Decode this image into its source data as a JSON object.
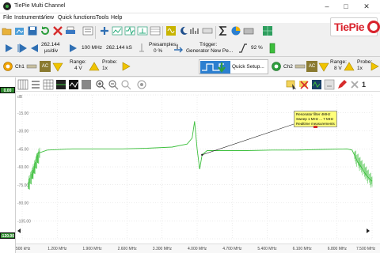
{
  "window": {
    "title": "TiePie Multi Channel",
    "minimize": "–",
    "maximize": "□",
    "close": "✕"
  },
  "menu": [
    "File",
    "Instruments",
    "View",
    "Quick functions",
    "Tools",
    "Help"
  ],
  "logo_text": "TiePie",
  "toolbar2": {
    "timebase_value": "262.144",
    "timebase_unit": "µs/div",
    "sample_rate": "100 MHz",
    "record_length": "262.144 kS",
    "presamples_label": "Presamples:",
    "presamples_value": "0 %",
    "trigger_label": "Trigger:",
    "trigger_value": "Generator New Pe...",
    "trigger_level": "92 %"
  },
  "toolbar3": {
    "ch1_label": "Ch1",
    "ch1_coupling": "AC",
    "ch1_range_label": "Range:",
    "ch1_range_value": "4 V",
    "ch1_probe_label": "Probe:",
    "ch1_probe_value": "1x",
    "quick_setup": "Quick Setup...",
    "ch2_label": "Ch2",
    "ch2_coupling": "AC",
    "ch2_range_label": "Range:",
    "ch2_range_value": "8 V",
    "ch2_probe_label": "Probe:",
    "ch2_probe_value": "1x"
  },
  "scope": {
    "close_number": "1",
    "y_marker_top": "0.00",
    "y_marker_bottom": "-120.00",
    "y_unit": "dB",
    "y_ticks": [
      "-15.00",
      "-30.00",
      "-45.00",
      "-60.00",
      "-75.00",
      "-90.00",
      "-105.00"
    ],
    "x_ticks": [
      "500 kHz",
      "1.200 MHz",
      "1.900 MHz",
      "2.600 MHz",
      "3.300 MHz",
      "4.000 MHz",
      "4.700 MHz",
      "5.400 MHz",
      "6.100 MHz",
      "6.800 MHz",
      "7.500 MHz"
    ],
    "note_lines": [
      "Resonator filter 4MHz",
      "Sweep 1 MHz ... 7 MHz",
      "Realtime measurements"
    ],
    "trace_color": "#3cbf3c"
  },
  "chart_data": {
    "type": "line",
    "xlabel": "",
    "ylabel": "dB",
    "ylim": [
      -120,
      0
    ],
    "xlim": [
      0.5,
      7.5
    ],
    "series": [
      {
        "color": "#3cbf3c",
        "x": [
          0.7,
          0.8,
          1.0,
          1.5,
          2.0,
          2.5,
          3.0,
          3.5,
          3.8,
          3.9,
          3.95,
          4.0,
          4.05,
          4.1,
          4.2,
          4.5,
          5.0,
          5.5,
          6.0,
          6.5,
          7.0,
          7.1,
          7.2,
          7.4,
          7.5
        ],
        "y": [
          -70,
          -49,
          -46,
          -45,
          -45,
          -45,
          -44.5,
          -43.5,
          -41,
          -36,
          -22,
          -45,
          -62,
          -50,
          -46.5,
          -46.5,
          -46.5,
          -46,
          -46,
          -45.5,
          -45,
          -46,
          -55,
          -68,
          -72
        ]
      }
    ]
  }
}
